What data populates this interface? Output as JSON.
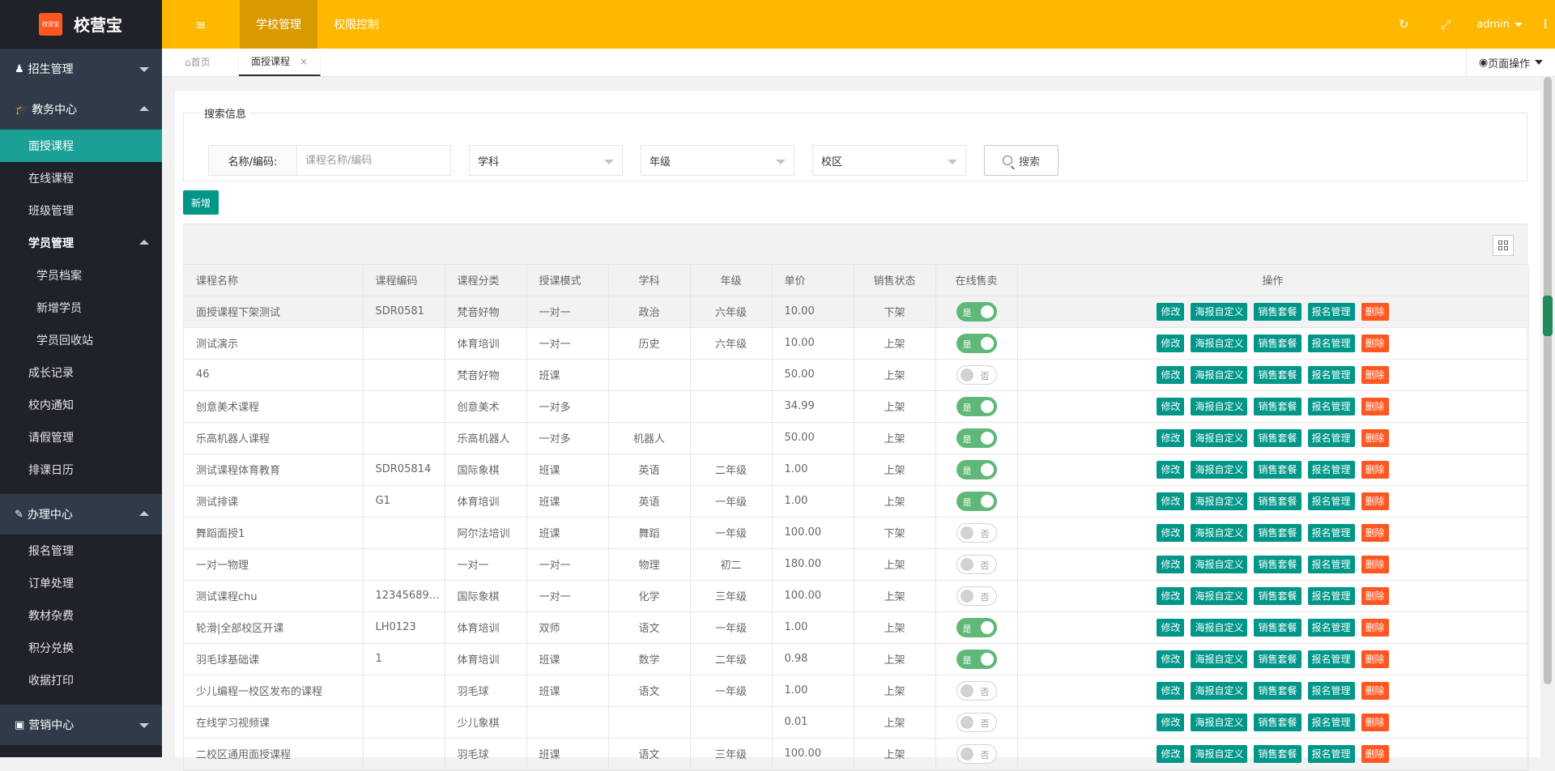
{
  "brand": {
    "logo_text": "校营宝",
    "mark_text": "校营宝"
  },
  "sidebar": {
    "groups": [
      {
        "label": "招生管理"
      },
      {
        "label": "教务中心"
      },
      {
        "label": "办理中心"
      },
      {
        "label": "营销中心"
      }
    ],
    "edu": [
      "面授课程",
      "在线课程",
      "班级管理"
    ],
    "student_mgmt": "学员管理",
    "student_sub": [
      "学员档案",
      "新增学员",
      "学员回收站"
    ],
    "edu2": [
      "成长记录",
      "校内通知",
      "请假管理",
      "排课日历"
    ],
    "handle": [
      "报名管理",
      "订单处理",
      "教材杂费",
      "积分兑换",
      "收据打印"
    ]
  },
  "header": {
    "nav": [
      "学校管理",
      "权限控制"
    ],
    "user": "admin"
  },
  "tabs": {
    "home": "首页",
    "current": "面授课程",
    "page_ops": "页面操作"
  },
  "search": {
    "legend": "搜索信息",
    "name_label": "名称/编码:",
    "name_placeholder": "课程名称/编码",
    "subject": "学科",
    "grade": "年级",
    "campus": "校区",
    "button": "搜索"
  },
  "add_button": "新增",
  "table": {
    "headers": [
      "课程名称",
      "课程编码",
      "课程分类",
      "授课模式",
      "学科",
      "年级",
      "单价",
      "销售状态",
      "在线售卖",
      "操作"
    ],
    "switch_on": "是",
    "switch_off": "否",
    "ops": [
      "修改",
      "海报自定义",
      "销售套餐",
      "报名管理",
      "删除"
    ],
    "rows": [
      [
        "面授课程下架测试",
        "SDR0581",
        "梵音好物",
        "一对一",
        "政治",
        "六年级",
        "10.00",
        "下架",
        true
      ],
      [
        "测试演示",
        "",
        "体育培训",
        "一对一",
        "历史",
        "六年级",
        "10.00",
        "上架",
        true
      ],
      [
        "46",
        "",
        "梵音好物",
        "班课",
        "",
        "",
        "50.00",
        "上架",
        false
      ],
      [
        "创意美术课程",
        "",
        "创意美术",
        "一对多",
        "",
        "",
        "34.99",
        "上架",
        true
      ],
      [
        "乐高机器人课程",
        "",
        "乐高机器人",
        "一对多",
        "机器人",
        "",
        "50.00",
        "上架",
        true
      ],
      [
        "测试课程体育教育",
        "SDR05814",
        "国际象棋",
        "班课",
        "英语",
        "二年级",
        "1.00",
        "上架",
        true
      ],
      [
        "测试排课",
        "G1",
        "体育培训",
        "班课",
        "英语",
        "一年级",
        "1.00",
        "上架",
        true
      ],
      [
        "舞蹈面授1",
        "",
        "阿尔法培训",
        "班课",
        "舞蹈",
        "一年级",
        "100.00",
        "下架",
        false
      ],
      [
        "一对一物理",
        "",
        "一对一",
        "一对一",
        "物理",
        "初二",
        "180.00",
        "上架",
        false
      ],
      [
        "测试课程chu",
        "123456892...",
        "国际象棋",
        "一对一",
        "化学",
        "三年级",
        "100.00",
        "上架",
        false
      ],
      [
        "轮滑|全部校区开课",
        "LH0123",
        "体育培训",
        "双师",
        "语文",
        "一年级",
        "1.00",
        "上架",
        true
      ],
      [
        "羽毛球基础课",
        "1",
        "体育培训",
        "班课",
        "数学",
        "二年级",
        "0.98",
        "上架",
        true
      ],
      [
        "少儿编程一校区发布的课程",
        "",
        "羽毛球",
        "班课",
        "语文",
        "一年级",
        "1.00",
        "上架",
        false
      ],
      [
        "在线学习视频课",
        "",
        "少儿象棋",
        "",
        "",
        "",
        "0.01",
        "上架",
        false
      ],
      [
        "二校区通用面授课程",
        "",
        "羽毛球",
        "班课",
        "语文",
        "三年级",
        "100.00",
        "上架",
        false
      ]
    ]
  }
}
